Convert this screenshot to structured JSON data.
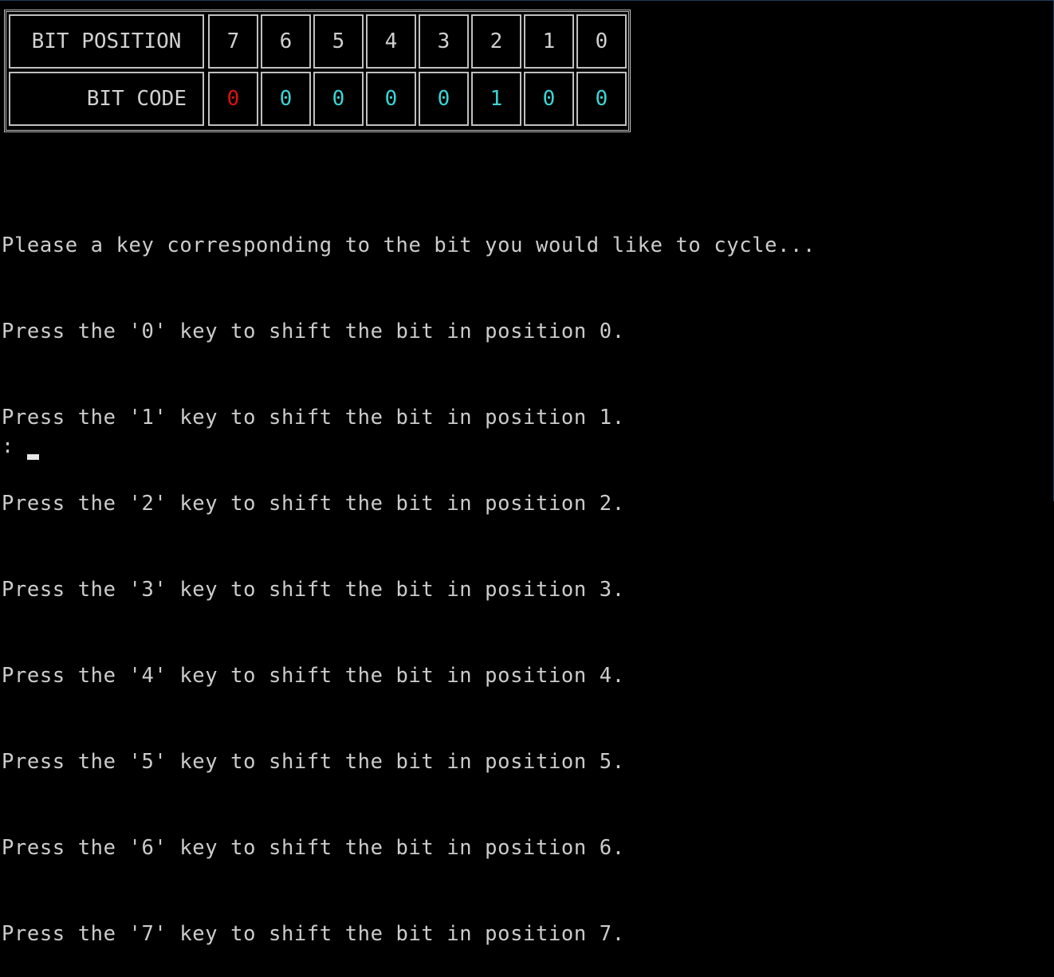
{
  "bit_table": {
    "position_label": "BIT POSITION",
    "code_label": "BIT CODE",
    "positions": [
      "7",
      "6",
      "5",
      "4",
      "3",
      "2",
      "1",
      "0"
    ],
    "codes": [
      {
        "value": "0",
        "color": "#e01010"
      },
      {
        "value": "0",
        "color": "#3ad6d6"
      },
      {
        "value": "0",
        "color": "#3ad6d6"
      },
      {
        "value": "0",
        "color": "#3ad6d6"
      },
      {
        "value": "0",
        "color": "#3ad6d6"
      },
      {
        "value": "1",
        "color": "#3ad6d6"
      },
      {
        "value": "0",
        "color": "#3ad6d6"
      },
      {
        "value": "0",
        "color": "#3ad6d6"
      }
    ]
  },
  "console": {
    "lines": [
      "Please a key corresponding to the bit you would like to cycle...",
      "Press the '0' key to shift the bit in position 0.",
      "Press the '1' key to shift the bit in position 1.",
      "Press the '2' key to shift the bit in position 2.",
      "Press the '3' key to shift the bit in position 3.",
      "Press the '4' key to shift the bit in position 4.",
      "Press the '5' key to shift the bit in position 5.",
      "Press the '6' key to shift the bit in position 6.",
      "Press the '7' key to shift the bit in position 7."
    ],
    "prompt": ":"
  }
}
